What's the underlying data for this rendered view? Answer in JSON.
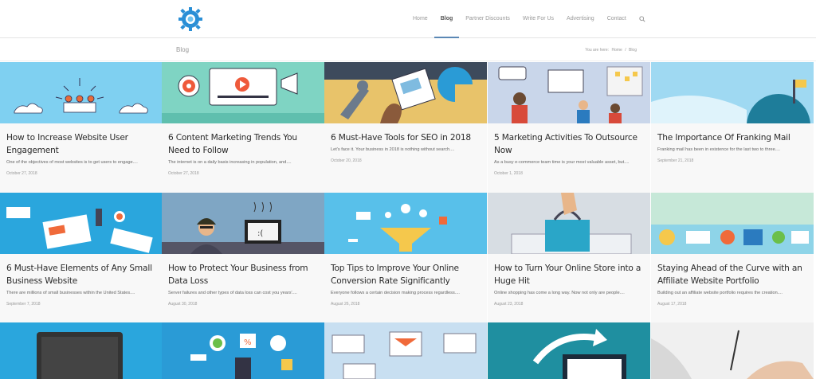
{
  "colors": {
    "accent": "#5b88b5",
    "logo": "#2a8fd6"
  },
  "header": {
    "logo_icon": "gear-logo-icon",
    "nav": [
      {
        "label": "Home"
      },
      {
        "label": "Blog"
      },
      {
        "label": "Partner Discounts"
      },
      {
        "label": "Write For Us"
      },
      {
        "label": "Advertising"
      },
      {
        "label": "Contact"
      }
    ],
    "search_icon": "search-icon"
  },
  "titlebar": {
    "title": "Blog",
    "crumb_prefix": "You are here:",
    "crumb_home": "Home",
    "crumb_sep": "/",
    "crumb_current": "Blog"
  },
  "posts": [
    {
      "title": "How to Increase Website User Engagement",
      "excerpt": "One of the objectives of most websites is to get users to engage....",
      "date": "October 27, 2018"
    },
    {
      "title": "6 Content Marketing Trends You Need to Follow",
      "excerpt": "The internet is on a daily basis increasing in population, and....",
      "date": "October 27, 2018"
    },
    {
      "title": "6 Must-Have Tools for SEO in 2018",
      "excerpt": "Let's face it. Your business in 2018 is nothing without search....",
      "date": "October 20, 2018"
    },
    {
      "title": "5 Marketing Activities To Outsource Now",
      "excerpt": "As a busy e-commerce team time is your most valuable asset, but....",
      "date": "October 1, 2018"
    },
    {
      "title": "The Importance Of Franking Mail",
      "excerpt": "Franking mail has been in existence for the last two to three....",
      "date": "September 21, 2018"
    },
    {
      "title": "6 Must-Have Elements of Any Small Business Website",
      "excerpt": "There are millions of small businesses within the United States....",
      "date": "September 7, 2018"
    },
    {
      "title": "How to Protect Your Business from Data Loss",
      "excerpt": "Server failures and other types of data loss can cost you years'....",
      "date": "August 30, 2018"
    },
    {
      "title": "Top Tips to Improve Your Online Conversion Rate Significantly",
      "excerpt": "Everyone follows a certain decision making process regardless....",
      "date": "August 26, 2018"
    },
    {
      "title": "How to Turn Your Online Store into a Huge Hit",
      "excerpt": "Online shopping has come a long way. Now not only are people....",
      "date": "August 23, 2018"
    },
    {
      "title": "Staying Ahead of the Curve with an Affiliate Website Portfolio",
      "excerpt": "Building out an affiliate website portfolio requires the creation....",
      "date": "August 17, 2018"
    }
  ],
  "bottom_row_thumbs": [
    "laptop-illustration",
    "marketing-icons-illustration",
    "analytics-dashboard-illustration",
    "website-arrow-illustration",
    "hand-writing-photo"
  ]
}
